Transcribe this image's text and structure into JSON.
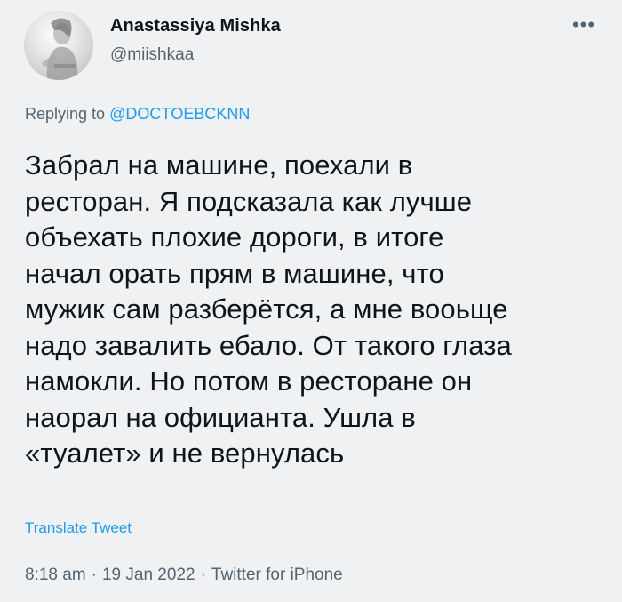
{
  "author": {
    "name": "Anastassiya Mishka",
    "handle": "@miishkaa",
    "avatar": "profile-photo"
  },
  "more_icon": "more-horizontal-icon",
  "more_glyph": "•••",
  "reply": {
    "prefix": "Replying to ",
    "mention": "@DОCTОEBCKNN"
  },
  "tweet": {
    "text": "Забрал на машине, поехали в\nресторан. Я подсказала как лучше\nобъехать плохие дороги, в итоге\nначал орать прям в машине, что\nмужик сам разберётся, а мне вооьще\nнадо завалить ебало. От такого глаза\nнамокли. Но потом в ресторане он\nнаорал на официанта. Ушла в\n«туалет» и не вернулась"
  },
  "translate_label": "Translate Tweet",
  "meta": {
    "time": "8:18 am",
    "date": "19 Jan 2022",
    "source": "Twitter for iPhone",
    "separator": "·"
  },
  "colors": {
    "background": "#f0f1f3",
    "text": "#0f1419",
    "secondary": "#536471",
    "link": "#1d9bf0"
  }
}
